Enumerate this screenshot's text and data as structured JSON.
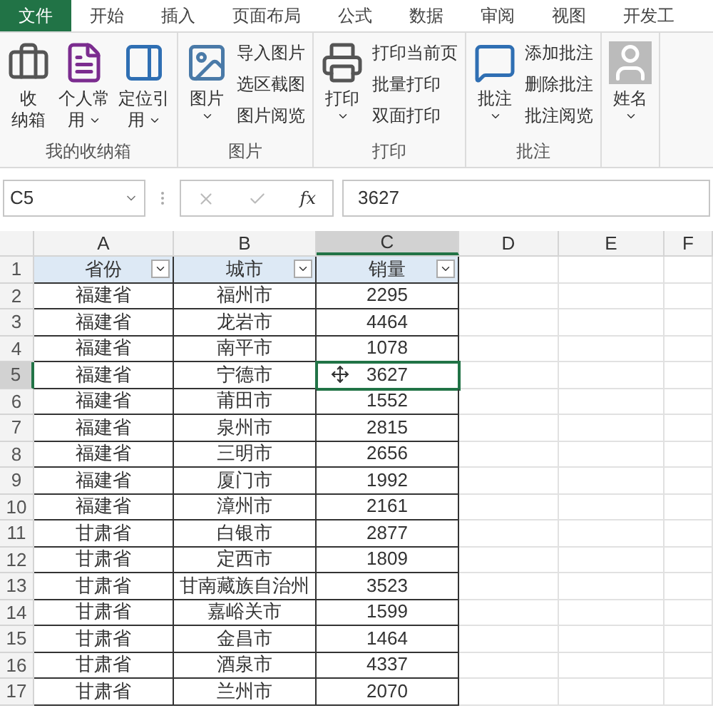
{
  "tabs": [
    {
      "label": "文件",
      "selected": true
    },
    {
      "label": "开始",
      "selected": false
    },
    {
      "label": "插入",
      "selected": false
    },
    {
      "label": "页面布局",
      "selected": false
    },
    {
      "label": "公式",
      "selected": false
    },
    {
      "label": "数据",
      "selected": false
    },
    {
      "label": "审阅",
      "selected": false
    },
    {
      "label": "视图",
      "selected": false
    },
    {
      "label": "开发工",
      "selected": false
    }
  ],
  "ribbon": [
    {
      "label": "我的收纳箱",
      "items": [
        {
          "kind": "large",
          "lines": [
            "收",
            "纳箱"
          ],
          "dropdown": false
        },
        {
          "kind": "large",
          "lines": [
            "个人常",
            "用"
          ],
          "dropdown": true
        },
        {
          "kind": "large",
          "lines": [
            "定位引",
            "用"
          ],
          "dropdown": true
        }
      ]
    },
    {
      "label": "图片",
      "items": [
        {
          "kind": "large",
          "lines": [
            "图片"
          ],
          "dropdown": true
        },
        {
          "kind": "stack",
          "labels": [
            "导入图片",
            "选区截图",
            "图片阅览"
          ]
        }
      ]
    },
    {
      "label": "打印",
      "items": [
        {
          "kind": "large",
          "lines": [
            "打印"
          ],
          "dropdown": true
        },
        {
          "kind": "stack",
          "labels": [
            "打印当前页",
            "批量打印",
            "双面打印"
          ]
        }
      ]
    },
    {
      "label": "批注",
      "items": [
        {
          "kind": "large",
          "lines": [
            "批注"
          ],
          "dropdown": true
        },
        {
          "kind": "stack",
          "labels": [
            "添加批注",
            "删除批注",
            "批注阅览"
          ]
        }
      ]
    },
    {
      "items": [
        {
          "kind": "large",
          "lines": [
            "姓名"
          ],
          "dropdown": true
        }
      ]
    }
  ],
  "formula_bar": {
    "name_box": "C5",
    "fx": "fx",
    "value": "3627"
  },
  "columns": [
    {
      "label": "A",
      "selected": false
    },
    {
      "label": "B",
      "selected": false
    },
    {
      "label": "C",
      "selected": true
    },
    {
      "label": "D",
      "selected": false
    },
    {
      "label": "E",
      "selected": false
    },
    {
      "label": "F",
      "selected": false
    }
  ],
  "rows": [
    {
      "number": "1",
      "selected": false,
      "header": true,
      "cells": [
        "省份",
        "城市",
        "销量"
      ]
    },
    {
      "number": "2",
      "selected": false,
      "header": false,
      "cells": [
        "福建省",
        "福州市",
        "2295"
      ]
    },
    {
      "number": "3",
      "selected": false,
      "header": false,
      "cells": [
        "福建省",
        "龙岩市",
        "4464"
      ]
    },
    {
      "number": "4",
      "selected": false,
      "header": false,
      "cells": [
        "福建省",
        "南平市",
        "1078"
      ]
    },
    {
      "number": "5",
      "selected": true,
      "header": false,
      "cells": [
        "福建省",
        "宁德市",
        "3627"
      ]
    },
    {
      "number": "6",
      "selected": false,
      "header": false,
      "cells": [
        "福建省",
        "莆田市",
        "1552"
      ]
    },
    {
      "number": "7",
      "selected": false,
      "header": false,
      "cells": [
        "福建省",
        "泉州市",
        "2815"
      ]
    },
    {
      "number": "8",
      "selected": false,
      "header": false,
      "cells": [
        "福建省",
        "三明市",
        "2656"
      ]
    },
    {
      "number": "9",
      "selected": false,
      "header": false,
      "cells": [
        "福建省",
        "厦门市",
        "1992"
      ]
    },
    {
      "number": "10",
      "selected": false,
      "header": false,
      "cells": [
        "福建省",
        "漳州市",
        "2161"
      ]
    },
    {
      "number": "11",
      "selected": false,
      "header": false,
      "cells": [
        "甘肃省",
        "白银市",
        "2877"
      ]
    },
    {
      "number": "12",
      "selected": false,
      "header": false,
      "cells": [
        "甘肃省",
        "定西市",
        "1809"
      ]
    },
    {
      "number": "13",
      "selected": false,
      "header": false,
      "cells": [
        "甘肃省",
        "甘南藏族自治州",
        "3523"
      ]
    },
    {
      "number": "14",
      "selected": false,
      "header": false,
      "cells": [
        "甘肃省",
        "嘉峪关市",
        "1599"
      ]
    },
    {
      "number": "15",
      "selected": false,
      "header": false,
      "cells": [
        "甘肃省",
        "金昌市",
        "1464"
      ]
    },
    {
      "number": "16",
      "selected": false,
      "header": false,
      "cells": [
        "甘肃省",
        "酒泉市",
        "4337"
      ]
    },
    {
      "number": "17",
      "selected": false,
      "header": false,
      "cells": [
        "甘肃省",
        "兰州市",
        "2070"
      ]
    }
  ]
}
